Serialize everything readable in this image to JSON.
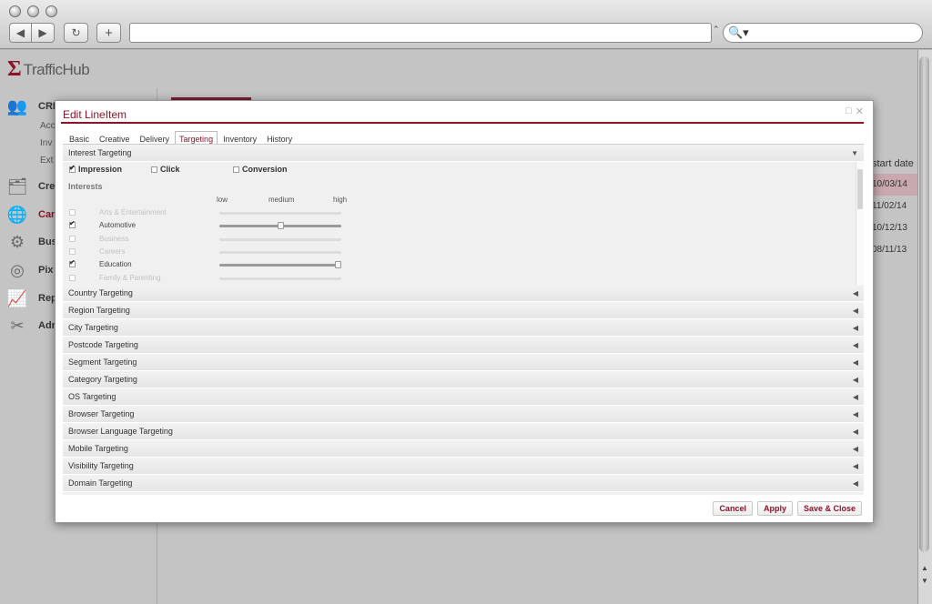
{
  "browser": {
    "back_glyph": "◀",
    "forward_glyph": "▶",
    "reload_glyph": "↻",
    "new_tab_glyph": "+",
    "url": "",
    "search_glyph": "🔍▾",
    "url_dropdown_glyph": "⌃"
  },
  "app": {
    "logo_mark": "Σ",
    "logo_text": "TrafficHub",
    "sidebar": [
      {
        "icon": "people-icon",
        "glyph": "👥",
        "label": "CRM"
      },
      {
        "icon": "creative-icon",
        "glyph": "🗂",
        "label": "Cre"
      },
      {
        "icon": "globe-icon",
        "glyph": "🌐",
        "label": "Can"
      },
      {
        "icon": "gears-icon",
        "glyph": "⚙",
        "label": "Bus"
      },
      {
        "icon": "target-icon",
        "glyph": "◎",
        "label": "Pix"
      },
      {
        "icon": "chart-icon",
        "glyph": "📈",
        "label": "Rep"
      },
      {
        "icon": "tools-icon",
        "glyph": "✂",
        "label": "Adr"
      }
    ],
    "crm_sub": [
      "Acc",
      "Inv",
      "Ext"
    ],
    "table": {
      "col_header": "start date",
      "rows": [
        "10/03/14",
        "11/02/14",
        "10/12/13",
        "08/11/13"
      ]
    }
  },
  "modal": {
    "title": "Edit LineItem",
    "maximize_glyph": "□",
    "close_glyph": "✕",
    "tabs": [
      "Basic",
      "Creative",
      "Delivery",
      "Targeting",
      "Inventory",
      "History"
    ],
    "active_tab": "Targeting",
    "interest": {
      "header": "Interest Targeting",
      "expanded_glyph": "▼",
      "modes": [
        {
          "label": "Impression",
          "checked": true
        },
        {
          "label": "Click",
          "checked": false
        },
        {
          "label": "Conversion",
          "checked": false
        }
      ],
      "interests_label": "Interests",
      "scale": {
        "low": "low",
        "medium": "medium",
        "high": "high"
      },
      "items": [
        {
          "label": "Arts & Entertainment",
          "checked": false,
          "level": null
        },
        {
          "label": "Automotive",
          "checked": true,
          "level": 0.5
        },
        {
          "label": "Business",
          "checked": false,
          "level": null
        },
        {
          "label": "Careers",
          "checked": false,
          "level": null
        },
        {
          "label": "Education",
          "checked": true,
          "level": 1.0
        },
        {
          "label": "Family & Parenting",
          "checked": false,
          "level": null
        }
      ]
    },
    "collapsed_glyph": "◀",
    "sections": [
      "Country Targeting",
      "Region Targeting",
      "City Targeting",
      "Postcode Targeting",
      "Segment Targeting",
      "Category Targeting",
      "OS Targeting",
      "Browser Targeting",
      "Browser Language Targeting",
      "Mobile Targeting",
      "Visibility Targeting",
      "Domain Targeting"
    ],
    "buttons": {
      "cancel": "Cancel",
      "apply": "Apply",
      "save_close": "Save & Close"
    }
  },
  "colors": {
    "accent": "#8b1428"
  }
}
